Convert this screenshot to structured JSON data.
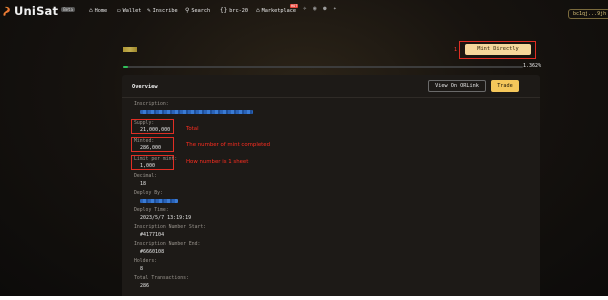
{
  "app": {
    "name": "UniSat",
    "beta_badge": "Beta"
  },
  "nav": {
    "items": [
      {
        "label": "Home",
        "icon": "home-icon"
      },
      {
        "label": "Wallet",
        "icon": "wallet-icon"
      },
      {
        "label": "Inscribe",
        "icon": "pen-icon"
      },
      {
        "label": "Search",
        "icon": "search-icon"
      },
      {
        "label": "brc-20",
        "icon": "brackets-icon"
      },
      {
        "label": "Marketplace",
        "icon": "bag-icon",
        "badge": "HOT"
      }
    ],
    "address": "bc1qj...9jh"
  },
  "token": {
    "mint_button": "Mint Directly",
    "annotation_number": "1",
    "progress_percent": 1.362,
    "progress_label": "1.362"
  },
  "panel": {
    "title": "Overview",
    "view_button": "View On ORLink",
    "trade_button": "Trade",
    "fields": {
      "inscription_label": "Inscription:",
      "supply_label": "Supply:",
      "supply_value": "21,000,000",
      "minted_label": "Minted:",
      "minted_value": "286,000",
      "limit_label": "Limit per mint:",
      "limit_value": "1,000",
      "decimals_label": "Decimal:",
      "decimals_value": "18",
      "deploy_by_label": "Deploy By:",
      "deploy_time_label": "Deploy Time:",
      "deploy_time_value": "2023/5/7 13:19:19",
      "num_start_label": "Inscription Number Start:",
      "num_start_value": "#4177104",
      "num_end_label": "Inscription Number End:",
      "num_end_value": "#6660108",
      "holders_label": "Holders:",
      "holders_value": "8",
      "tx_label": "Total Transactions:",
      "tx_value": "286"
    },
    "annotations": {
      "supply": "Total",
      "minted": "The number of mint completed",
      "limit": "How number is 1 sheet"
    }
  },
  "colors": {
    "accent": "#f5c75b",
    "mint_button": "#f5d79b",
    "annotation": "#ff2d20",
    "progress": "#30c05a",
    "link": "#3a7bd5"
  }
}
